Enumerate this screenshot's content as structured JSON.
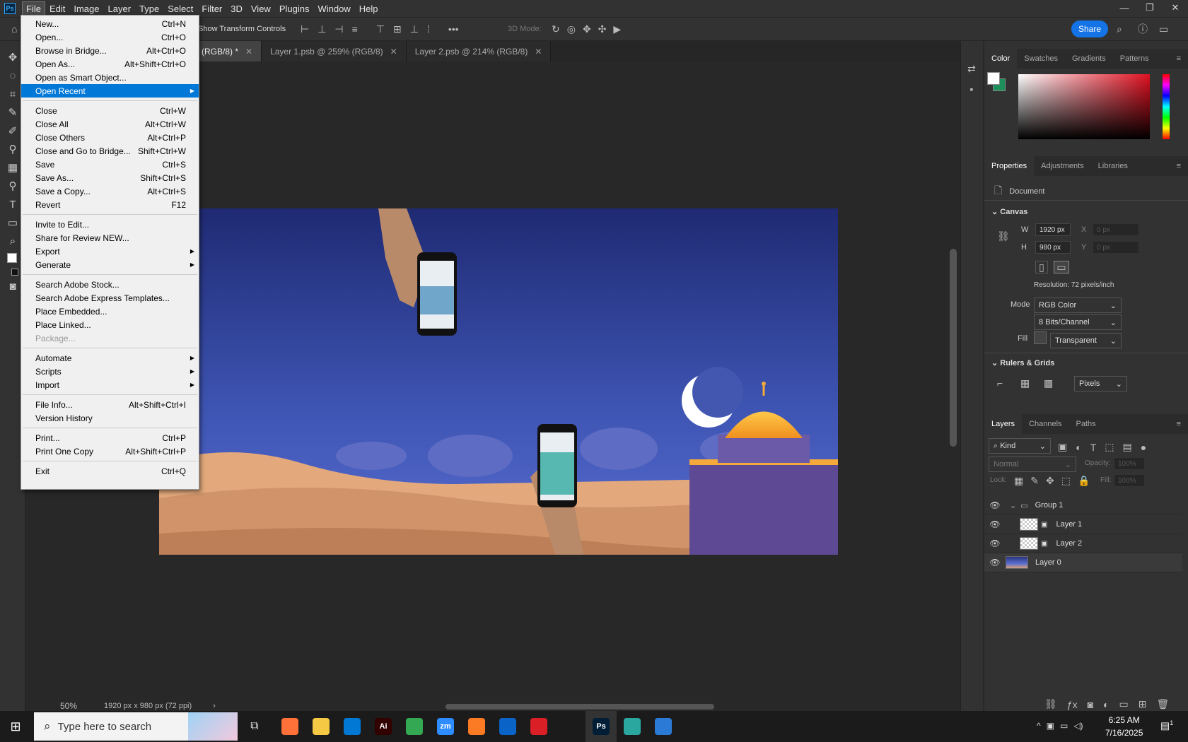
{
  "menubar": {
    "app_icon": "Ps",
    "items": [
      "File",
      "Edit",
      "Image",
      "Layer",
      "Type",
      "Select",
      "Filter",
      "3D",
      "View",
      "Plugins",
      "Window",
      "Help"
    ],
    "window_buttons": [
      "—",
      "❐",
      "✕"
    ]
  },
  "options_bar": {
    "show_transform": "Show Transform Controls",
    "mode_3d": "3D Mode:",
    "share": "Share"
  },
  "tabs": [
    {
      "label": "(RGB/8) *",
      "active": true
    },
    {
      "label": "Layer 1.psb @ 259% (RGB/8)",
      "active": false
    },
    {
      "label": "Layer 2.psb @ 214% (RGB/8)",
      "active": false
    }
  ],
  "file_menu": {
    "groups": [
      [
        {
          "label": "New...",
          "shortcut": "Ctrl+N"
        },
        {
          "label": "Open...",
          "shortcut": "Ctrl+O"
        },
        {
          "label": "Browse in Bridge...",
          "shortcut": "Alt+Ctrl+O"
        },
        {
          "label": "Open As...",
          "shortcut": "Alt+Shift+Ctrl+O"
        },
        {
          "label": "Open as Smart Object...",
          "shortcut": ""
        },
        {
          "label": "Open Recent",
          "shortcut": "",
          "submenu": true,
          "highlighted": true
        }
      ],
      [
        {
          "label": "Close",
          "shortcut": "Ctrl+W"
        },
        {
          "label": "Close All",
          "shortcut": "Alt+Ctrl+W"
        },
        {
          "label": "Close Others",
          "shortcut": "Alt+Ctrl+P"
        },
        {
          "label": "Close and Go to Bridge...",
          "shortcut": "Shift+Ctrl+W"
        },
        {
          "label": "Save",
          "shortcut": "Ctrl+S"
        },
        {
          "label": "Save As...",
          "shortcut": "Shift+Ctrl+S"
        },
        {
          "label": "Save a Copy...",
          "shortcut": "Alt+Ctrl+S"
        },
        {
          "label": "Revert",
          "shortcut": "F12"
        }
      ],
      [
        {
          "label": "Invite to Edit...",
          "shortcut": ""
        },
        {
          "label": "Share for Review NEW...",
          "shortcut": ""
        },
        {
          "label": "Export",
          "shortcut": "",
          "submenu": true
        },
        {
          "label": "Generate",
          "shortcut": "",
          "submenu": true
        }
      ],
      [
        {
          "label": "Search Adobe Stock...",
          "shortcut": ""
        },
        {
          "label": "Search Adobe Express Templates...",
          "shortcut": ""
        },
        {
          "label": "Place Embedded...",
          "shortcut": ""
        },
        {
          "label": "Place Linked...",
          "shortcut": ""
        },
        {
          "label": "Package...",
          "shortcut": "",
          "disabled": true
        }
      ],
      [
        {
          "label": "Automate",
          "shortcut": "",
          "submenu": true
        },
        {
          "label": "Scripts",
          "shortcut": "",
          "submenu": true
        },
        {
          "label": "Import",
          "shortcut": "",
          "submenu": true
        }
      ],
      [
        {
          "label": "File Info...",
          "shortcut": "Alt+Shift+Ctrl+I"
        },
        {
          "label": "Version History",
          "shortcut": ""
        }
      ],
      [
        {
          "label": "Print...",
          "shortcut": "Ctrl+P"
        },
        {
          "label": "Print One Copy",
          "shortcut": "Alt+Shift+Ctrl+P"
        }
      ],
      [
        {
          "label": "Exit",
          "shortcut": "Ctrl+Q"
        }
      ]
    ]
  },
  "status": {
    "zoom": "50%",
    "doc_info": "1920 px x 980 px (72 ppi)"
  },
  "color_panel": {
    "tabs": [
      "Color",
      "Swatches",
      "Gradients",
      "Patterns"
    ],
    "fg": "#ffffff",
    "bg": "#1c8f5a"
  },
  "properties": {
    "tabs": [
      "Properties",
      "Adjustments",
      "Libraries"
    ],
    "doc_label": "Document",
    "canvas_title": "Canvas",
    "w_label": "W",
    "w": "1920 px",
    "x_label": "X",
    "x_placeholder": "0 px",
    "h_label": "H",
    "h": "980 px",
    "y_label": "Y",
    "y_placeholder": "0 px",
    "resolution": "Resolution: 72 pixels/inch",
    "mode_label": "Mode",
    "mode": "RGB Color",
    "bits": "8 Bits/Channel",
    "fill_label": "Fill",
    "fill": "Transparent",
    "rulers_title": "Rulers & Grids",
    "units": "Pixels"
  },
  "layers_panel": {
    "tabs": [
      "Layers",
      "Channels",
      "Paths"
    ],
    "kind": "Kind",
    "blend": "Normal",
    "opacity_label": "Opacity:",
    "opacity": "100%",
    "lock_label": "Lock:",
    "fill_label": "Fill:",
    "fill": "100%",
    "layers": [
      {
        "name": "Group 1",
        "type": "group"
      },
      {
        "name": "Layer 1",
        "type": "smart"
      },
      {
        "name": "Layer 2",
        "type": "smart"
      },
      {
        "name": "Layer 0",
        "type": "image"
      }
    ]
  },
  "taskbar": {
    "search_placeholder": "Type here to search",
    "time": "6:25 AM",
    "date": "7/16/2025",
    "notif": "1",
    "apps": [
      {
        "name": "firefox",
        "label": "",
        "color": "#ff7139"
      },
      {
        "name": "explorer",
        "label": "",
        "color": "#f6c945"
      },
      {
        "name": "vscode",
        "label": "",
        "color": "#0078d4"
      },
      {
        "name": "illustrator",
        "label": "Ai",
        "color": "#330000"
      },
      {
        "name": "chrome",
        "label": "",
        "color": "#34a853"
      },
      {
        "name": "zoom",
        "label": "zm",
        "color": "#2d8cff"
      },
      {
        "name": "xampp",
        "label": "",
        "color": "#fb7a24"
      },
      {
        "name": "outlook",
        "label": "",
        "color": "#0a64c8"
      },
      {
        "name": "creative-cloud",
        "label": "",
        "color": "#da1f26"
      },
      {
        "name": "pen-tool",
        "label": "",
        "color": "#1b1b1b"
      },
      {
        "name": "photoshop",
        "label": "Ps",
        "color": "#001e36"
      },
      {
        "name": "app-diamond",
        "label": "",
        "color": "#2aa8a0"
      },
      {
        "name": "photos",
        "label": "",
        "color": "#2b7bd6"
      }
    ]
  }
}
